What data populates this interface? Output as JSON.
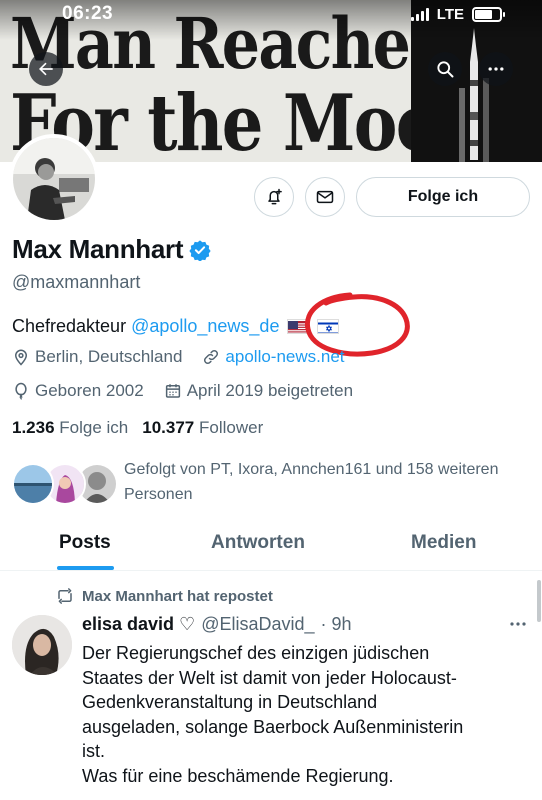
{
  "status_bar": {
    "time": "06:23",
    "network": "LTE"
  },
  "banner": {
    "line1": "Man Reaches",
    "line2": "For the Moon"
  },
  "icons": {
    "back": "arrow-left-icon",
    "search": "search-icon",
    "more": "more-horizontal-icon",
    "notify": "bell-plus-icon",
    "message": "envelope-icon",
    "verified": "verified-badge-icon",
    "location": "location-pin-icon",
    "link": "link-icon",
    "birthday": "balloon-icon",
    "calendar": "calendar-icon",
    "repost": "repost-icon"
  },
  "profile": {
    "follow_button": "Folge ich",
    "name": "Max Mannhart",
    "handle": "@maxmannhart",
    "bio_text": "Chefredakteur ",
    "bio_link": "@apollo_news_de",
    "bio_flags": [
      "🇺🇸",
      "🇮🇱"
    ],
    "location": "Berlin, Deutschland",
    "website": "apollo-news.net",
    "birthday": "Geboren 2002",
    "joined": "April 2019 beigetreten",
    "following_count": "1.236",
    "following_label": "Folge ich",
    "followers_count": "10.377",
    "followers_label": "Follower",
    "followed_by": "Gefolgt von PT, Ixora, Annchen161 und 158 weiteren Personen"
  },
  "tabs": [
    {
      "label": "Posts",
      "active": true
    },
    {
      "label": "Antworten",
      "active": false
    },
    {
      "label": "Medien",
      "active": false
    }
  ],
  "post": {
    "repost_label": "Max Mannhart hat repostet",
    "author": "elisa david ♡",
    "handle": "@ElisaDavid_",
    "time": "· 9h",
    "text": "Der Regierungschef des einzigen jüdischen\nStaates der Welt ist damit von jeder Holocaust-\nGedenkveranstaltung in Deutschland\nausgeladen, solange Baerbock Außenministerin\nist.\nWas für eine beschämende Regierung."
  },
  "colors": {
    "accent": "#1d9bf0",
    "text": "#0f1419",
    "muted": "#536471",
    "annotation": "#e0242b"
  }
}
